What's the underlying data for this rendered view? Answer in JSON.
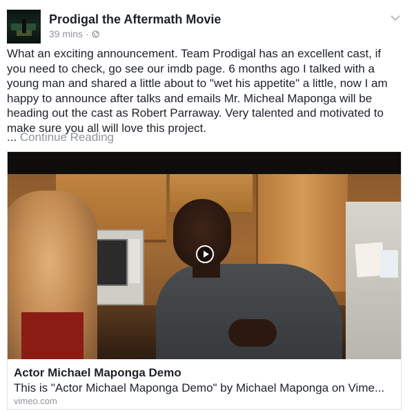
{
  "post": {
    "page_name": "Prodigal the Aftermath Movie",
    "timestamp": "39 mins",
    "separator": "·",
    "privacy_icon": "globe-icon",
    "menu_icon": "chevron-down-icon",
    "body": "What an exciting announcement. Team Prodigal has an excellent cast, if\nyou need to check, go see our imdb page. 6 months ago I talked with a\nyoung man and shared a little about to \"wet his appetite\" a little, now I am\nhappy to announce after talks and emails  Mr. Micheal Maponga will be\nheading out the cast as Robert Parraway.  Very talented and motivated to\nmake sure you all will love this project.",
    "ellipsis": "...",
    "continue_label": "Continue Reading"
  },
  "link_card": {
    "title": "Actor Michael Maponga Demo",
    "description": "This is \"Actor Michael Maponga Demo\" by Michael Maponga on Vime...",
    "domain": "vimeo.com",
    "play_icon": "play-icon"
  },
  "colors": {
    "text": "#1d2129",
    "secondary": "#90949c",
    "border": "#dddfe2"
  }
}
